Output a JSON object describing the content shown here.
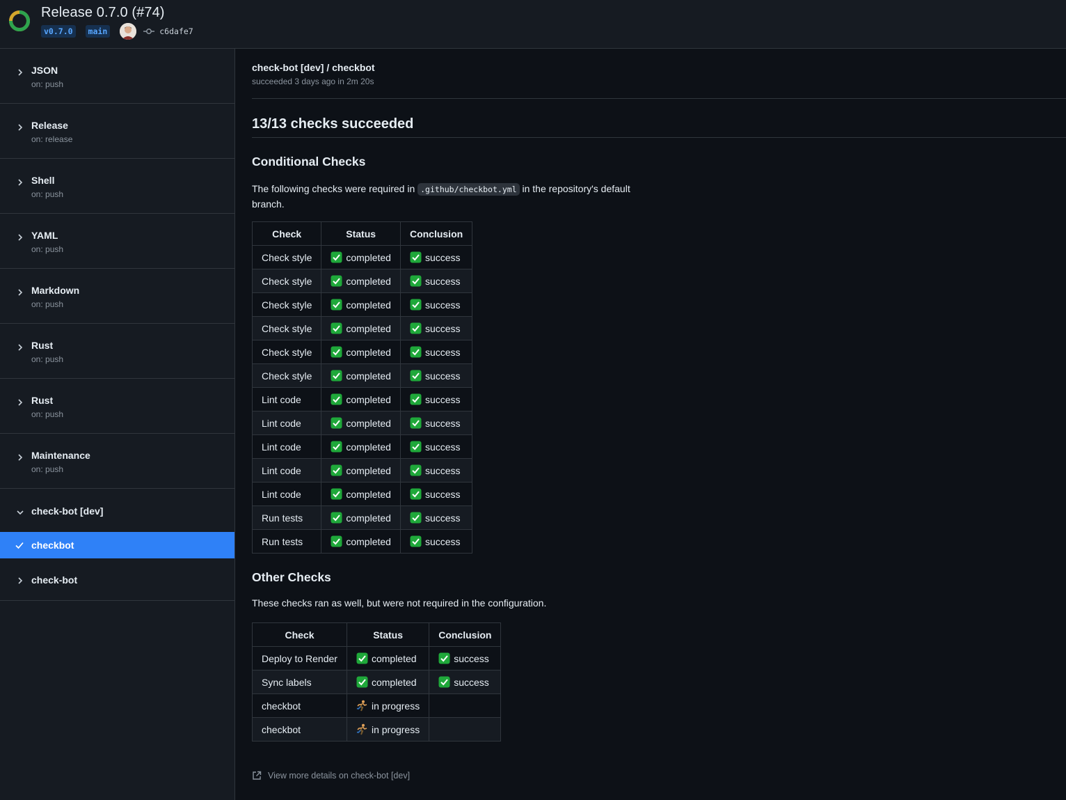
{
  "header": {
    "title": "Release 0.7.0 (#74)",
    "tag": "v0.7.0",
    "branch": "main",
    "commit": "c6dafe7",
    "status_colors": {
      "done": "#2da44e",
      "pending": "#d4a72c"
    }
  },
  "sidebar": {
    "workflows": [
      {
        "name": "JSON",
        "trigger": "on: push"
      },
      {
        "name": "Release",
        "trigger": "on: release"
      },
      {
        "name": "Shell",
        "trigger": "on: push"
      },
      {
        "name": "YAML",
        "trigger": "on: push"
      },
      {
        "name": "Markdown",
        "trigger": "on: push"
      },
      {
        "name": "Rust",
        "trigger": "on: push"
      },
      {
        "name": "Rust",
        "trigger": "on: push"
      },
      {
        "name": "Maintenance",
        "trigger": "on: push"
      }
    ],
    "expanded_workflow": "check-bot [dev]",
    "selected_job": "checkbot",
    "last_workflow": "check-bot",
    "accent": "#2f81f7"
  },
  "main": {
    "job_title": "check-bot [dev] / checkbot",
    "job_subtitle": "succeeded 3 days ago in 2m 20s",
    "summary": "13/13 checks succeeded",
    "conditional": {
      "heading": "Conditional Checks",
      "text_before": "The following checks were required in ",
      "code": ".github/checkbot.yml",
      "text_after": " in the repository's default branch.",
      "columns": [
        "Check",
        "Status",
        "Conclusion"
      ],
      "rows": [
        [
          "Check style",
          "completed",
          "success"
        ],
        [
          "Check style",
          "completed",
          "success"
        ],
        [
          "Check style",
          "completed",
          "success"
        ],
        [
          "Check style",
          "completed",
          "success"
        ],
        [
          "Check style",
          "completed",
          "success"
        ],
        [
          "Check style",
          "completed",
          "success"
        ],
        [
          "Lint code",
          "completed",
          "success"
        ],
        [
          "Lint code",
          "completed",
          "success"
        ],
        [
          "Lint code",
          "completed",
          "success"
        ],
        [
          "Lint code",
          "completed",
          "success"
        ],
        [
          "Lint code",
          "completed",
          "success"
        ],
        [
          "Run tests",
          "completed",
          "success"
        ],
        [
          "Run tests",
          "completed",
          "success"
        ]
      ]
    },
    "other": {
      "heading": "Other Checks",
      "text": "These checks ran as well, but were not required in the configuration.",
      "columns": [
        "Check",
        "Status",
        "Conclusion"
      ],
      "rows": [
        [
          "Deploy to Render",
          "completed",
          "success"
        ],
        [
          "Sync labels",
          "completed",
          "success"
        ],
        [
          "checkbot",
          "in progress",
          ""
        ],
        [
          "checkbot",
          "in progress",
          ""
        ]
      ]
    },
    "details_link": "View more details on check-bot [dev]"
  }
}
